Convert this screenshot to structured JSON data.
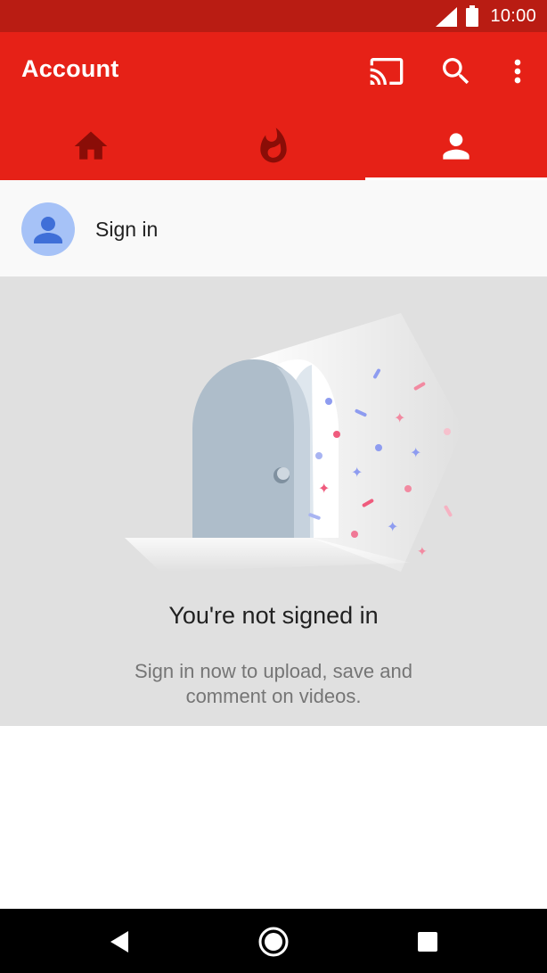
{
  "status_bar": {
    "time": "10:00",
    "icons": [
      "signal-icon",
      "battery-icon"
    ]
  },
  "app_bar": {
    "title": "Account",
    "actions": [
      "cast-icon",
      "search-icon",
      "more-vert-icon"
    ],
    "colors": {
      "status_bar": "#b91c13",
      "app_bar": "#e62117",
      "active_tab_icon": "#ffffff",
      "inactive_tab_icon": "#8a0d07"
    }
  },
  "tabs": [
    {
      "icon": "home-icon",
      "active": false
    },
    {
      "icon": "trending-fire-icon",
      "active": false
    },
    {
      "icon": "account-icon",
      "active": true
    }
  ],
  "signin_row": {
    "label": "Sign in",
    "avatar_color": "#a6c2f7",
    "avatar_icon_color": "#3f6fd8"
  },
  "empty_state": {
    "title": "You're not signed in",
    "subtitle": "Sign in now to upload, save and comment on videos."
  },
  "nav_bar": {
    "buttons": [
      "back-icon",
      "home-circle-icon",
      "recents-icon"
    ]
  }
}
